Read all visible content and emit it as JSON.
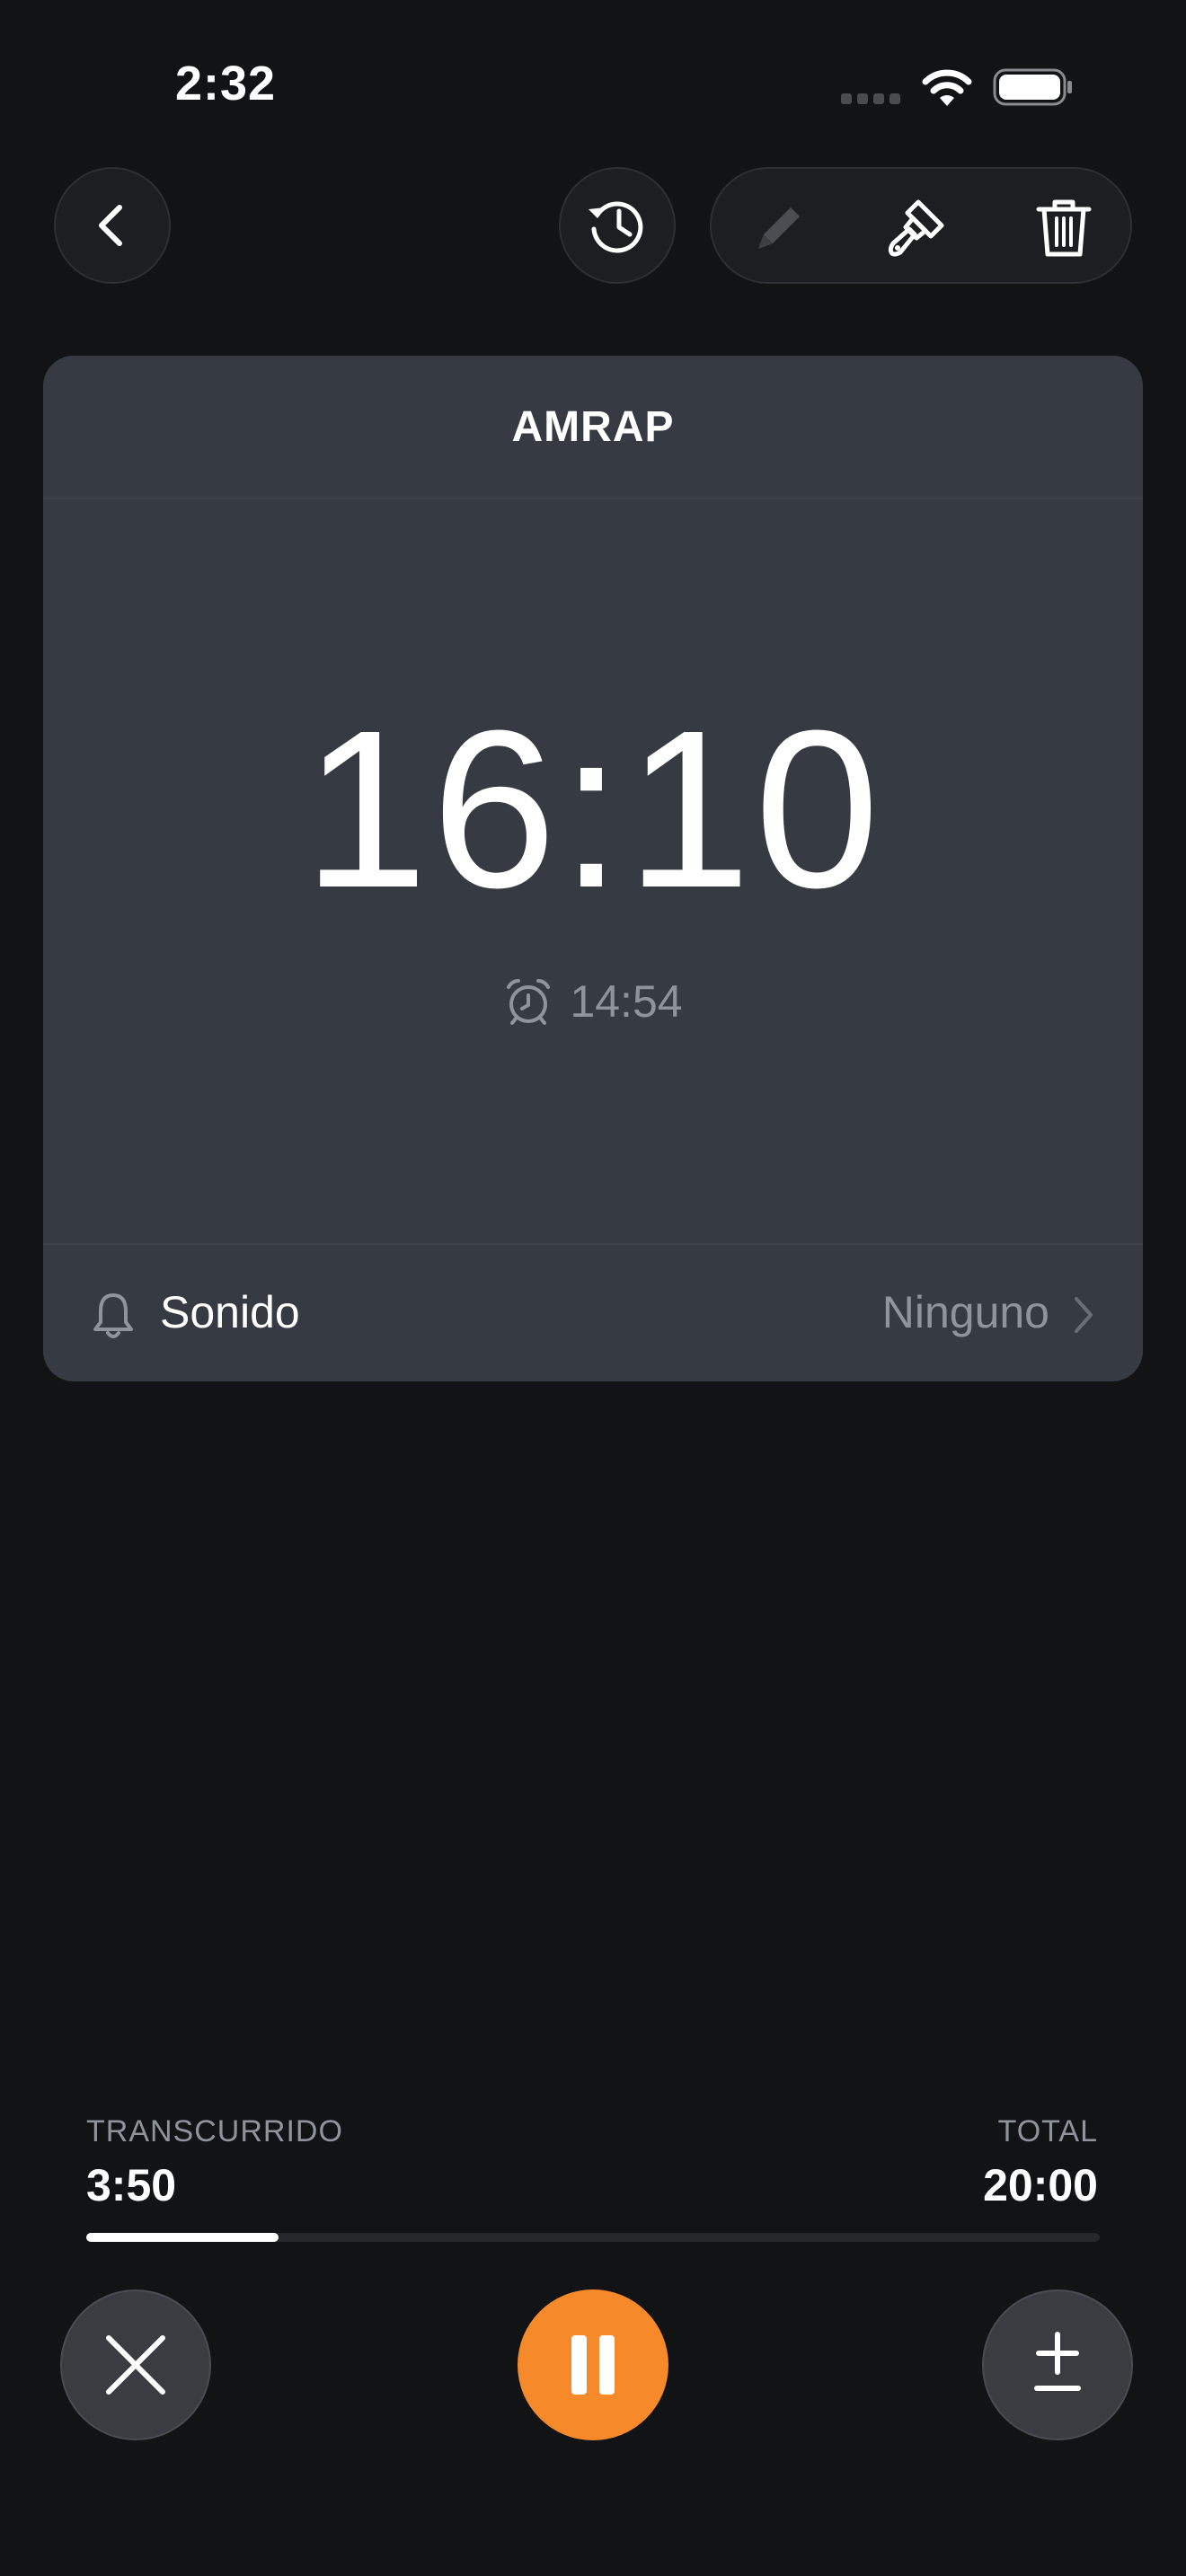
{
  "status_bar": {
    "time": "2:32"
  },
  "card": {
    "title": "AMRAP",
    "countdown": "16:10",
    "alarm_time": "14:54",
    "sound_label": "Sonido",
    "sound_value": "Ninguno"
  },
  "progress": {
    "elapsed_label": "TRANSCURRIDO",
    "elapsed_value": "3:50",
    "total_label": "TOTAL",
    "total_value": "20:00",
    "fraction": 0.19
  },
  "colors": {
    "accent": "#f68a2a",
    "background": "#121315",
    "card": "#363a42",
    "secondary_text": "#8f939b"
  },
  "icons": {
    "back": "chevron-left-icon",
    "history": "history-icon",
    "edit": "pencil-icon",
    "theme": "paintbrush-icon",
    "delete": "trash-icon",
    "alarm": "alarm-clock-icon",
    "sound": "bell-icon",
    "cancel": "close-icon",
    "pause": "pause-icon",
    "adjust": "plus-minus-icon"
  }
}
